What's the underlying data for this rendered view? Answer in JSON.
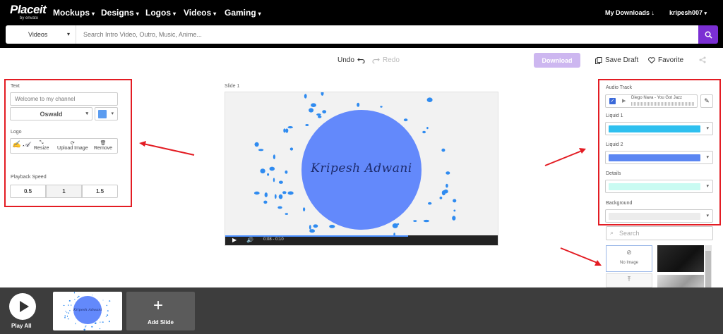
{
  "brand": {
    "name": "Placeit",
    "sub": "by envato"
  },
  "nav": [
    {
      "label": "Mockups"
    },
    {
      "label": "Designs"
    },
    {
      "label": "Logos"
    },
    {
      "label": "Videos"
    },
    {
      "label": "Gaming"
    }
  ],
  "header_right": {
    "downloads": "My Downloads",
    "user": "kripesh007"
  },
  "search": {
    "category": "Videos",
    "placeholder": "Search Intro Video, Outro, Music, Anime..."
  },
  "toolbar": {
    "undo": "Undo",
    "redo": "Redo",
    "download": "Download",
    "save_draft": "Save Draft",
    "favorite": "Favorite"
  },
  "left_panel": {
    "text_label": "Text",
    "text_placeholder": "Welcome to my channel",
    "font": "Oswald",
    "text_color": "#5b9cf0",
    "logo_label": "Logo",
    "logo_tools": {
      "resize": "Resize",
      "upload": "Upload Image",
      "remove": "Remove"
    },
    "speed_label": "Playback Speed",
    "speeds": [
      "0.5",
      "1",
      "1.5"
    ],
    "selected_speed": "1"
  },
  "preview": {
    "slide_label": "Slide 1",
    "title": "Kripesh Adwani",
    "time": "0:08 - 0:10",
    "progress": 0.67,
    "circle_color": "#6389fb",
    "splash_color": "#2f8bf0"
  },
  "right_panel": {
    "audio_label": "Audio Track",
    "audio_track": "Diego Nava - You Got Jazz",
    "liquid1_label": "Liquid 1",
    "liquid1_color": "#2fc0ef",
    "liquid2_label": "Liquid 2",
    "liquid2_color": "#5b86f2",
    "details_label": "Details",
    "details_color": "#c9fbf2",
    "background_label": "Background",
    "background_color": "#ececec",
    "bg_search_placeholder": "Search",
    "no_image_label": "No Image"
  },
  "bottom": {
    "play_all": "Play All",
    "add_slide": "Add Slide"
  }
}
